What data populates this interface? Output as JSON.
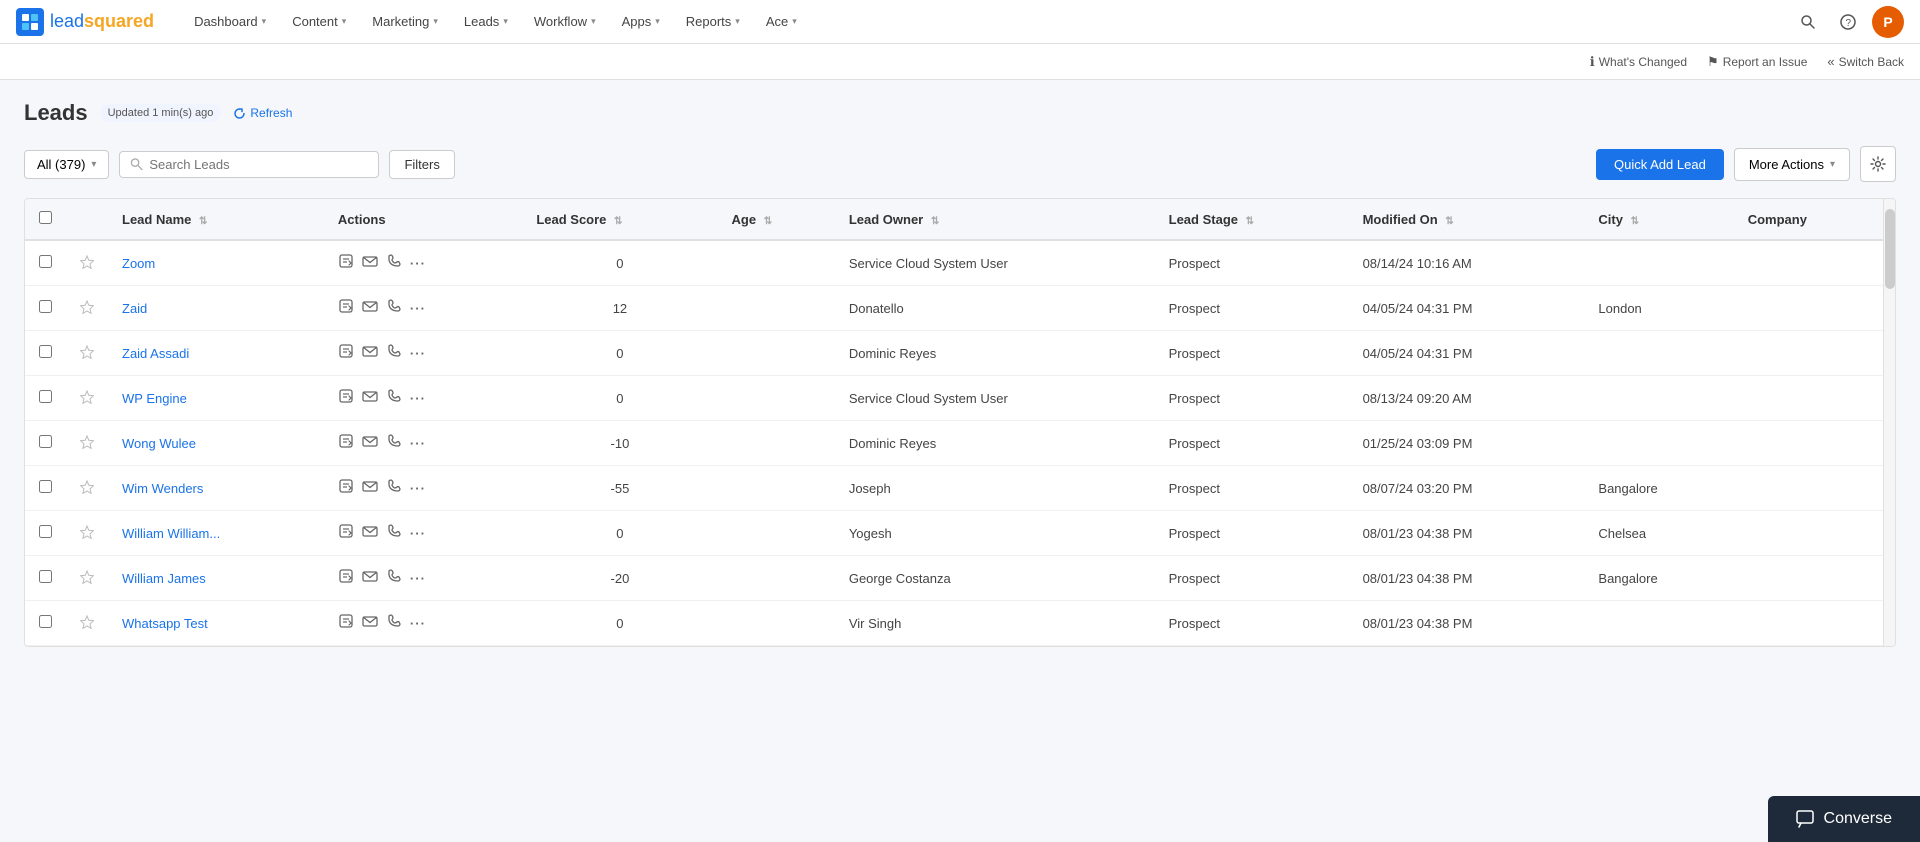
{
  "logo": {
    "icon_text": "ls",
    "text_part1": "lead",
    "text_part2": "squared"
  },
  "nav": {
    "items": [
      {
        "label": "Dashboard",
        "has_caret": true
      },
      {
        "label": "Content",
        "has_caret": true
      },
      {
        "label": "Marketing",
        "has_caret": true
      },
      {
        "label": "Leads",
        "has_caret": true
      },
      {
        "label": "Workflow",
        "has_caret": true
      },
      {
        "label": "Apps",
        "has_caret": true
      },
      {
        "label": "Reports",
        "has_caret": true
      },
      {
        "label": "Ace",
        "has_caret": true
      }
    ],
    "avatar_text": "P"
  },
  "sub_nav": {
    "items": [
      {
        "icon": "ℹ",
        "label": "What's Changed"
      },
      {
        "icon": "⚑",
        "label": "Report an Issue"
      },
      {
        "icon": "«",
        "label": "Switch Back"
      }
    ]
  },
  "page": {
    "title": "Leads",
    "updated_text": "Updated 1 min(s) ago",
    "refresh_label": "Refresh"
  },
  "toolbar": {
    "all_count_label": "All (379)",
    "search_placeholder": "Search Leads",
    "filters_label": "Filters",
    "quick_add_label": "Quick Add Lead",
    "more_actions_label": "More Actions",
    "settings_tooltip": "Settings"
  },
  "table": {
    "columns": [
      {
        "label": "Lead Name",
        "sortable": true
      },
      {
        "label": "Actions",
        "sortable": false
      },
      {
        "label": "Lead Score",
        "sortable": true
      },
      {
        "label": "Age",
        "sortable": true
      },
      {
        "label": "Lead Owner",
        "sortable": true
      },
      {
        "label": "Lead Stage",
        "sortable": true
      },
      {
        "label": "Modified On",
        "sortable": true
      },
      {
        "label": "City",
        "sortable": true
      },
      {
        "label": "Company",
        "sortable": false
      }
    ],
    "rows": [
      {
        "name": "Zoom",
        "score": "0",
        "age": "",
        "owner": "Service Cloud System User",
        "stage": "Prospect",
        "modified": "08/14/24 10:16 AM",
        "city": "",
        "company": ""
      },
      {
        "name": "Zaid",
        "score": "12",
        "age": "",
        "owner": "Donatello",
        "stage": "Prospect",
        "modified": "04/05/24 04:31 PM",
        "city": "London",
        "company": ""
      },
      {
        "name": "Zaid Assadi",
        "score": "0",
        "age": "",
        "owner": "Dominic Reyes",
        "stage": "Prospect",
        "modified": "04/05/24 04:31 PM",
        "city": "",
        "company": ""
      },
      {
        "name": "WP Engine",
        "score": "0",
        "age": "",
        "owner": "Service Cloud System User",
        "stage": "Prospect",
        "modified": "08/13/24 09:20 AM",
        "city": "",
        "company": ""
      },
      {
        "name": "Wong Wulee",
        "score": "-10",
        "age": "",
        "owner": "Dominic Reyes",
        "stage": "Prospect",
        "modified": "01/25/24 03:09 PM",
        "city": "",
        "company": ""
      },
      {
        "name": "Wim Wenders",
        "score": "-55",
        "age": "",
        "owner": "Joseph",
        "stage": "Prospect",
        "modified": "08/07/24 03:20 PM",
        "city": "Bangalore",
        "company": ""
      },
      {
        "name": "William William...",
        "score": "0",
        "age": "",
        "owner": "Yogesh",
        "stage": "Prospect",
        "modified": "08/01/23 04:38 PM",
        "city": "Chelsea",
        "company": ""
      },
      {
        "name": "William James",
        "score": "-20",
        "age": "",
        "owner": "George Costanza",
        "stage": "Prospect",
        "modified": "08/01/23 04:38 PM",
        "city": "Bangalore",
        "company": ""
      },
      {
        "name": "Whatsapp Test",
        "score": "0",
        "age": "",
        "owner": "Vir Singh",
        "stage": "Prospect",
        "modified": "08/01/23 04:38 PM",
        "city": "",
        "company": ""
      }
    ]
  },
  "converse": {
    "label": "Converse"
  }
}
